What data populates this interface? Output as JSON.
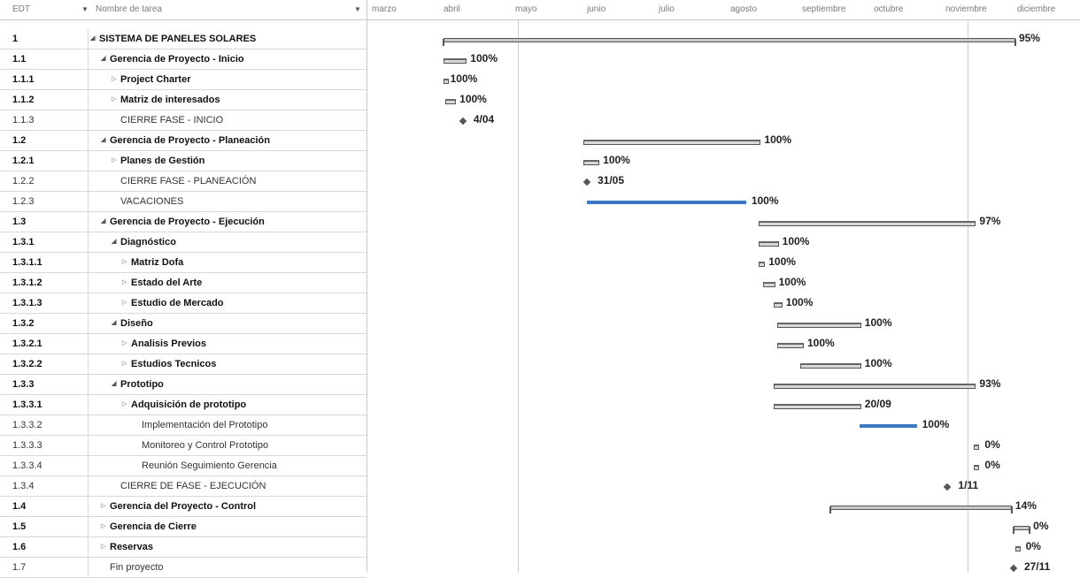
{
  "grid": {
    "headers": {
      "wbs": "EDT",
      "name": "Nombre de tarea"
    },
    "rows": [
      {
        "wbs": "1",
        "name": "SISTEMA DE PANELES SOLARES",
        "bold": true,
        "toggle": "expanded",
        "indent": 0
      },
      {
        "wbs": "1.1",
        "name": "Gerencia de Proyecto - Inicio",
        "bold": true,
        "toggle": "expanded",
        "indent": 1
      },
      {
        "wbs": "1.1.1",
        "name": "Project Charter",
        "bold": true,
        "toggle": "collapsed",
        "indent": 2
      },
      {
        "wbs": "1.1.2",
        "name": "Matriz de interesados",
        "bold": true,
        "toggle": "collapsed",
        "indent": 2
      },
      {
        "wbs": "1.1.3",
        "name": "CIERRE FASE - INICIO",
        "bold": false,
        "toggle": "none",
        "indent": 2
      },
      {
        "wbs": "1.2",
        "name": "Gerencia de Proyecto - Planeación",
        "bold": true,
        "toggle": "expanded",
        "indent": 1
      },
      {
        "wbs": "1.2.1",
        "name": "Planes de Gestión",
        "bold": true,
        "toggle": "collapsed",
        "indent": 2
      },
      {
        "wbs": "1.2.2",
        "name": "CIERRE FASE - PLANEACIÓN",
        "bold": false,
        "toggle": "none",
        "indent": 2
      },
      {
        "wbs": "1.2.3",
        "name": "VACACIONES",
        "bold": false,
        "toggle": "none",
        "indent": 2
      },
      {
        "wbs": "1.3",
        "name": "Gerencia de Proyecto - Ejecución",
        "bold": true,
        "toggle": "expanded",
        "indent": 1
      },
      {
        "wbs": "1.3.1",
        "name": "Diagnóstico",
        "bold": true,
        "toggle": "expanded",
        "indent": 2
      },
      {
        "wbs": "1.3.1.1",
        "name": "Matriz Dofa",
        "bold": true,
        "toggle": "collapsed",
        "indent": 3
      },
      {
        "wbs": "1.3.1.2",
        "name": "Estado del Arte",
        "bold": true,
        "toggle": "collapsed",
        "indent": 3
      },
      {
        "wbs": "1.3.1.3",
        "name": "Estudio de Mercado",
        "bold": true,
        "toggle": "collapsed",
        "indent": 3
      },
      {
        "wbs": "1.3.2",
        "name": "Diseño",
        "bold": true,
        "toggle": "expanded",
        "indent": 2
      },
      {
        "wbs": "1.3.2.1",
        "name": "Analisis Previos",
        "bold": true,
        "toggle": "collapsed",
        "indent": 3
      },
      {
        "wbs": "1.3.2.2",
        "name": "Estudios Tecnicos",
        "bold": true,
        "toggle": "collapsed",
        "indent": 3
      },
      {
        "wbs": "1.3.3",
        "name": "Prototipo",
        "bold": true,
        "toggle": "expanded",
        "indent": 2
      },
      {
        "wbs": "1.3.3.1",
        "name": "Adquisición de prototipo",
        "bold": true,
        "toggle": "collapsed",
        "indent": 3
      },
      {
        "wbs": "1.3.3.2",
        "name": "Implementación del Prototipo",
        "bold": false,
        "toggle": "none",
        "indent": 4
      },
      {
        "wbs": "1.3.3.3",
        "name": "Monitoreo y Control Prototipo",
        "bold": false,
        "toggle": "none",
        "indent": 4
      },
      {
        "wbs": "1.3.3.4",
        "name": "Reunión Seguimiento Gerencia",
        "bold": false,
        "toggle": "none",
        "indent": 4
      },
      {
        "wbs": "1.3.4",
        "name": "CIERRE DE FASE - EJECUCIÓN",
        "bold": false,
        "toggle": "none",
        "indent": 2
      },
      {
        "wbs": "1.4",
        "name": "Gerencia del Proyecto - Control",
        "bold": true,
        "toggle": "collapsed",
        "indent": 1
      },
      {
        "wbs": "1.5",
        "name": "Gerencia de Cierre",
        "bold": true,
        "toggle": "collapsed",
        "indent": 1
      },
      {
        "wbs": "1.6",
        "name": "Reservas",
        "bold": true,
        "toggle": "collapsed",
        "indent": 1
      },
      {
        "wbs": "1.7",
        "name": "Fin proyecto",
        "bold": false,
        "toggle": "none",
        "indent": 1
      }
    ]
  },
  "timeline": {
    "months": [
      "marzo",
      "abril",
      "mayo",
      "junio",
      "julio",
      "agosto",
      "septiembre",
      "octubre",
      "noviembre",
      "diciembre"
    ]
  },
  "gantt": [
    {
      "row": 0,
      "kind": "summary",
      "start": 1.0,
      "end": 8.95,
      "label": "95%"
    },
    {
      "row": 1,
      "kind": "task",
      "start": 1.0,
      "end": 1.3,
      "label": "100%"
    },
    {
      "row": 2,
      "kind": "task",
      "start": 1.0,
      "end": 1.02,
      "label": "100%"
    },
    {
      "row": 3,
      "kind": "task",
      "start": 1.02,
      "end": 1.15,
      "label": "100%"
    },
    {
      "row": 4,
      "kind": "milestone",
      "start": 1.27,
      "label": "4/04"
    },
    {
      "row": 5,
      "kind": "task",
      "start": 2.95,
      "end": 5.4,
      "label": "100%"
    },
    {
      "row": 6,
      "kind": "task",
      "start": 2.95,
      "end": 3.15,
      "label": "100%"
    },
    {
      "row": 7,
      "kind": "milestone",
      "start": 3.0,
      "label": "31/05"
    },
    {
      "row": 8,
      "kind": "blue",
      "start": 3.0,
      "end": 5.22,
      "label": "100%"
    },
    {
      "row": 9,
      "kind": "task",
      "start": 5.4,
      "end": 8.4,
      "label": "97%"
    },
    {
      "row": 10,
      "kind": "task",
      "start": 5.4,
      "end": 5.65,
      "label": "100%"
    },
    {
      "row": 11,
      "kind": "task",
      "start": 5.4,
      "end": 5.46,
      "label": "100%"
    },
    {
      "row": 12,
      "kind": "task",
      "start": 5.46,
      "end": 5.6,
      "label": "100%"
    },
    {
      "row": 13,
      "kind": "task",
      "start": 5.6,
      "end": 5.7,
      "label": "100%"
    },
    {
      "row": 14,
      "kind": "task",
      "start": 5.65,
      "end": 6.8,
      "label": "100%"
    },
    {
      "row": 15,
      "kind": "task",
      "start": 5.65,
      "end": 6.0,
      "label": "100%"
    },
    {
      "row": 16,
      "kind": "task",
      "start": 5.98,
      "end": 6.8,
      "label": "100%"
    },
    {
      "row": 17,
      "kind": "task",
      "start": 5.6,
      "end": 8.4,
      "label": "93%"
    },
    {
      "row": 18,
      "kind": "task",
      "start": 5.6,
      "end": 6.8,
      "label": "20/09"
    },
    {
      "row": 19,
      "kind": "blue",
      "start": 6.8,
      "end": 7.6,
      "label": "100%"
    },
    {
      "row": 20,
      "kind": "small",
      "start": 8.4,
      "label": "0%"
    },
    {
      "row": 21,
      "kind": "small",
      "start": 8.4,
      "label": "0%"
    },
    {
      "row": 22,
      "kind": "milestone",
      "start": 8.03,
      "label": "1/11"
    },
    {
      "row": 23,
      "kind": "summary",
      "start": 6.4,
      "end": 8.9,
      "label": "14%"
    },
    {
      "row": 24,
      "kind": "summary",
      "start": 8.95,
      "end": 9.15,
      "label": "0%"
    },
    {
      "row": 25,
      "kind": "small",
      "start": 8.97,
      "label": "0%"
    },
    {
      "row": 26,
      "kind": "milestone",
      "start": 8.95,
      "label": "27/11"
    }
  ],
  "colors": {
    "bar_border": "#555555",
    "bar_fill": "#d8d8d8",
    "blue": "#3a78c4",
    "grid_line": "#d8d8d8"
  }
}
